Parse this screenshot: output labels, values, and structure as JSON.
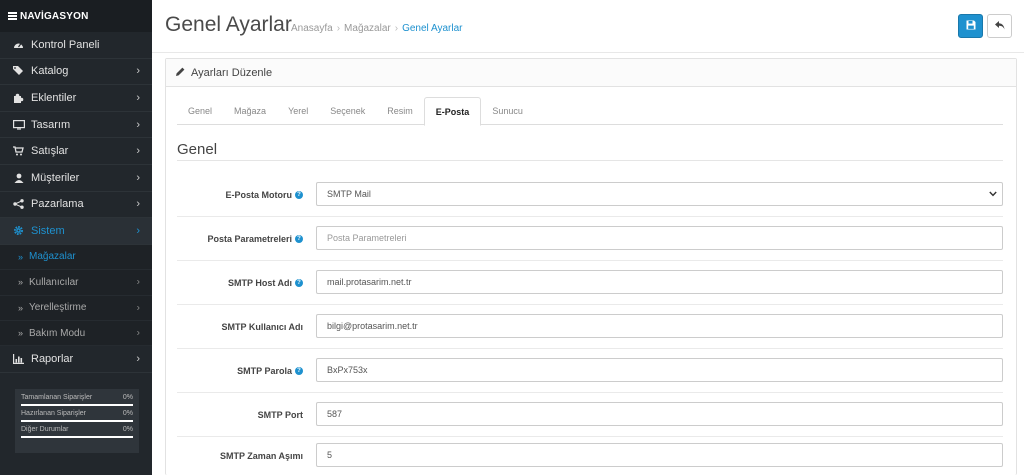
{
  "sidebar": {
    "header": "NAVİGASYON",
    "items": [
      {
        "label": "Kontrol Paneli",
        "icon": "dashboard-icon"
      },
      {
        "label": "Katalog",
        "icon": "tag-icon"
      },
      {
        "label": "Eklentiler",
        "icon": "puzzle-icon"
      },
      {
        "label": "Tasarım",
        "icon": "monitor-icon"
      },
      {
        "label": "Satışlar",
        "icon": "cart-icon"
      },
      {
        "label": "Müşteriler",
        "icon": "user-icon"
      },
      {
        "label": "Pazarlama",
        "icon": "share-icon"
      },
      {
        "label": "Sistem",
        "icon": "gear-icon"
      }
    ],
    "subitems": [
      {
        "label": "Mağazalar"
      },
      {
        "label": "Kullanıcılar"
      },
      {
        "label": "Yerelleştirme"
      },
      {
        "label": "Bakım Modu"
      }
    ],
    "reports": {
      "label": "Raporlar",
      "icon": "bar-chart-icon"
    },
    "progress": [
      {
        "label": "Tamamlanan Siparişler",
        "value": "0%",
        "fraction": 0
      },
      {
        "label": "Hazırlanan Siparişler",
        "value": "0%",
        "fraction": 0
      },
      {
        "label": "Diğer Durumlar",
        "value": "0%",
        "fraction": 0
      }
    ]
  },
  "header": {
    "title": "Genel Ayarlar",
    "breadcrumb": [
      "Anasayfa",
      "Mağazalar",
      "Genel Ayarlar"
    ],
    "sep": "›"
  },
  "panel": {
    "heading": "Ayarları Düzenle",
    "tabs": [
      "Genel",
      "Mağaza",
      "Yerel",
      "Seçenek",
      "Resim",
      "E-Posta",
      "Sunucu"
    ],
    "active_tab": "E-Posta",
    "section_title": "Genel"
  },
  "form": {
    "mail_engine": {
      "label": "E-Posta Motoru",
      "value": "SMTP Mail"
    },
    "mail_params": {
      "label": "Posta Parametreleri",
      "placeholder": "Posta Parametreleri"
    },
    "smtp_host": {
      "label": "SMTP Host Adı",
      "value": "mail.protasarim.net.tr"
    },
    "smtp_user": {
      "label": "SMTP Kullanıcı Adı",
      "value": "bilgi@protasarim.net.tr"
    },
    "smtp_pass": {
      "label": "SMTP Parola",
      "value": "BxPx753x"
    },
    "smtp_port": {
      "label": "SMTP Port",
      "value": "587"
    },
    "smtp_timeout": {
      "label": "SMTP Zaman Aşımı",
      "value": "5"
    }
  },
  "colors": {
    "accent": "#1e91cf",
    "sidebar_bg": "#22272c"
  }
}
